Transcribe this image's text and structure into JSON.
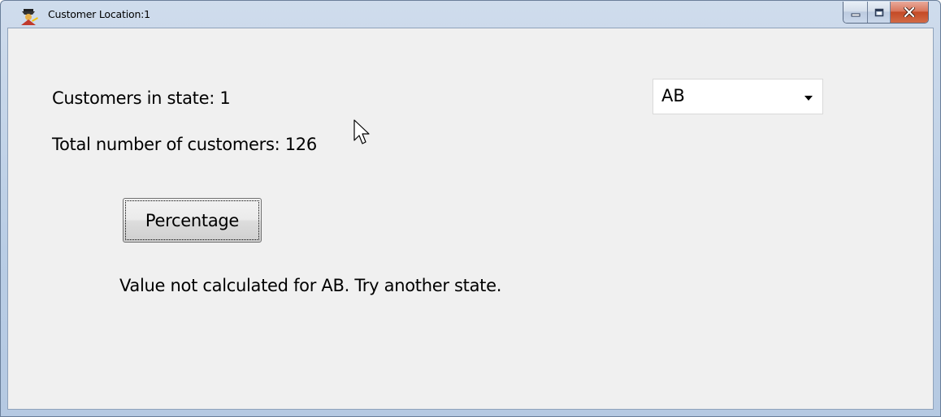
{
  "window": {
    "title": "Customer Location:1",
    "icon": "app-logo-icon",
    "controls": [
      "minimize-icon",
      "maximize-icon",
      "close-icon"
    ],
    "colors": {
      "frame": "#b9cde5",
      "client": "#f0f0f0",
      "close_button": "#c44a26"
    }
  },
  "form": {
    "customers_in_state_label": "Customers in state: 1",
    "total_customers_label": "Total number of customers: 126",
    "state_select": {
      "selected": "AB"
    },
    "percentage_button_label": "Percentage",
    "message": "Value not calculated for AB. Try another state."
  },
  "cursor": "mouse-pointer-icon"
}
